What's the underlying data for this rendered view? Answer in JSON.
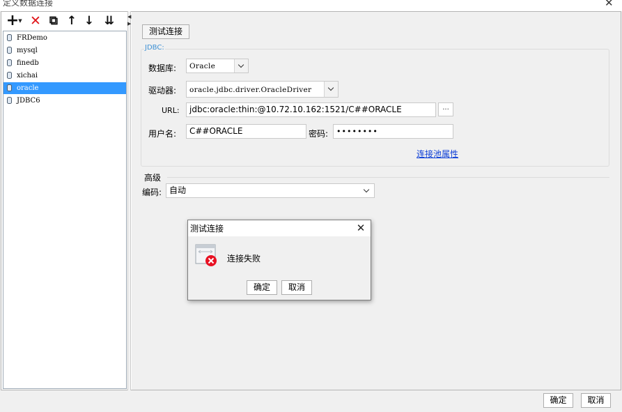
{
  "window": {
    "title": "定义数据连接",
    "close_glyph": "✕"
  },
  "toolbar": {
    "add_glyph": "+",
    "add_caret": "▼",
    "delete_glyph": "✕",
    "copy_glyph": "⧉",
    "move_up_glyph": "↑",
    "move_down_glyph": "↓",
    "move_bottom_glyph": "⇊"
  },
  "connections": [
    {
      "name": "FRDemo",
      "selected": false
    },
    {
      "name": "mysql",
      "selected": false
    },
    {
      "name": "finedb",
      "selected": false
    },
    {
      "name": "xichai",
      "selected": false
    },
    {
      "name": "oracle",
      "selected": true
    },
    {
      "name": "JDBC6",
      "selected": false
    }
  ],
  "splitter": {
    "left_arrow": "◀",
    "right_arrow": "▶"
  },
  "form": {
    "test_button": "测试连接",
    "jdbc_section": "JDBC:",
    "database_label": "数据库:",
    "database_value": "Oracle",
    "driver_label": "驱动器:",
    "driver_value": "oracle.jdbc.driver.OracleDriver",
    "url_label": "URL:",
    "url_value": "jdbc:oracle:thin:@10.72.10.162:1521/C##ORACLE",
    "url_browse": "...",
    "username_label": "用户名:",
    "username_value": "C##ORACLE",
    "password_label": "密码:",
    "password_value": "••••••••",
    "pool_link": "连接池属性",
    "advanced_section": "高级",
    "encoding_label": "编码:",
    "encoding_value": "自动"
  },
  "footer": {
    "ok": "确定",
    "cancel": "取消"
  },
  "popup": {
    "title": "测试连接",
    "close_glyph": "✕",
    "message": "连接失败",
    "ok": "确定",
    "cancel": "取消",
    "icon": "connection-error-icon",
    "error_color": "#e81123"
  },
  "colors": {
    "selection": "#3399ff",
    "accent_label": "#3b8fd4",
    "link": "#0b3dd6",
    "delete": "#e0161a"
  }
}
